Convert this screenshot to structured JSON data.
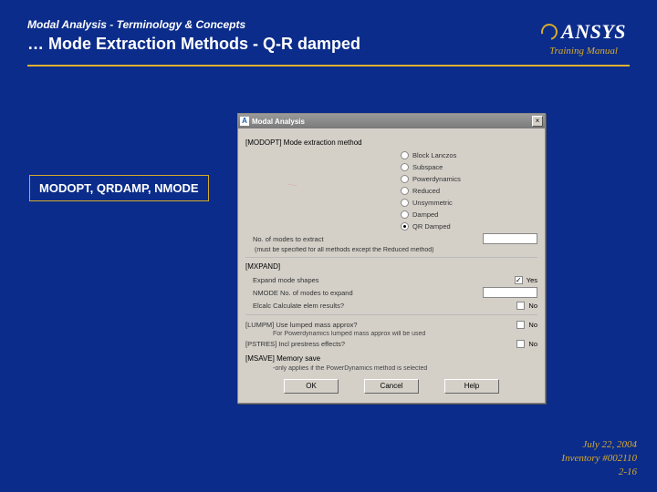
{
  "header": {
    "topline": "Modal Analysis - Terminology & Concepts",
    "title": "… Mode Extraction Methods - Q-R damped"
  },
  "logo": {
    "brand": "ANSYS",
    "sub": "Training Manual"
  },
  "callout": {
    "text": "MODOPT, QRDAMP, NMODE"
  },
  "dialog": {
    "title": "Modal Analysis",
    "group_method": "[MODOPT] Mode extraction method",
    "radios": [
      {
        "label": "Block Lanczos",
        "checked": false
      },
      {
        "label": "Subspace",
        "checked": false
      },
      {
        "label": "Powerdynamics",
        "checked": false
      },
      {
        "label": "Reduced",
        "checked": false
      },
      {
        "label": "Unsymmetric",
        "checked": false
      },
      {
        "label": "Damped",
        "checked": false
      },
      {
        "label": "QR Damped",
        "checked": true
      }
    ],
    "nmodes_label": "No. of modes to extract",
    "nmodes_value": "",
    "nmodes_note": "(must be specified for all methods except the Reduced method)",
    "group_expand": "[MXPAND]",
    "expand_label": "Expand mode shapes",
    "expand_checked": "✓",
    "expand_opt": "Yes",
    "nmode_expand_label": "NMODE No. of modes to expand",
    "nmode_expand_value": "",
    "elcalc_label": "Elcalc Calculate elem results?",
    "elcalc_opt": "No",
    "group_lump": "[LUMPM] Use lumped mass approx?",
    "lump_opt": "No",
    "lump_note": "For Powerdynamics lumped mass approx will be used",
    "group_pstres": "[PSTRES] Incl prestress effects?",
    "pstres_opt": "No",
    "group_save": "[MSAVE] Memory save",
    "save_note": "-only applies if the PowerDynamics method is selected",
    "buttons": {
      "ok": "OK",
      "cancel": "Cancel",
      "help": "Help"
    }
  },
  "footer": {
    "date": "July 22, 2004",
    "inventory": "Inventory #002110",
    "page": "2-16"
  }
}
